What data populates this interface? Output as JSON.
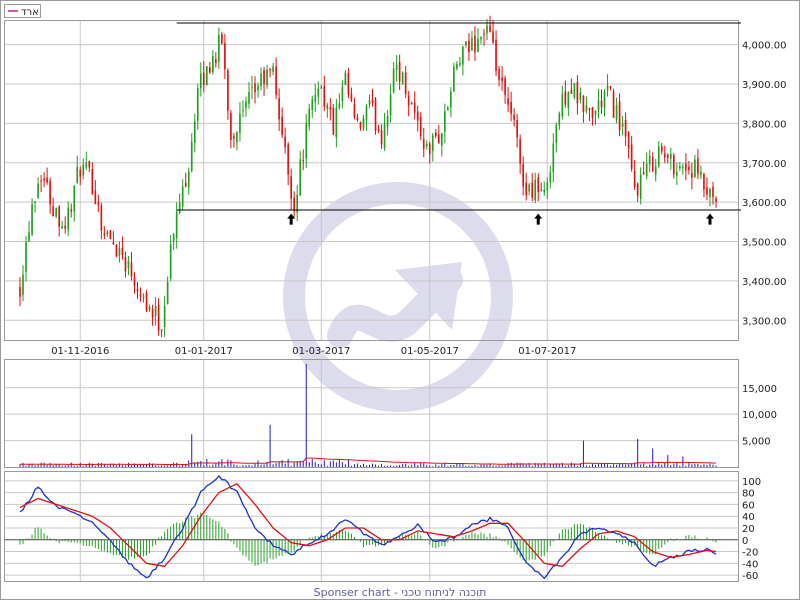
{
  "legend": {
    "label": "ארד",
    "color": "#d11b8a"
  },
  "footer": {
    "text": "Sponser chart - תוכנה לניתוח טכני"
  },
  "colors": {
    "up": "#1f9e1f",
    "down": "#e01010",
    "volume": "#1a1acb",
    "volume_ma": "#e01010",
    "macd": "#1a33c9",
    "signal": "#e01010",
    "hist": "#28a028",
    "grid": "#c8c8c8",
    "watermark": "#d6d6ea"
  },
  "chart_data": [
    {
      "type": "candlestick",
      "panel": "price",
      "y_ticks": [
        "4,000.00",
        "3,900.00",
        "3,800.00",
        "3,700.00",
        "3,600.00",
        "3,500.00",
        "3,400.00",
        "3,300.00"
      ],
      "ylim": [
        3250,
        4060
      ],
      "x_ticks": [
        "01-11-2016",
        "01-01-2017",
        "01-03-2017",
        "01-05-2017",
        "01-07-2017"
      ],
      "x_tick_index": [
        20,
        61,
        100,
        136,
        175
      ],
      "n_bars": 232,
      "resistance": {
        "level": 4055,
        "from_index": 52,
        "to_index": 231
      },
      "support": {
        "level": 3580,
        "from_index": 52,
        "to_index": 231
      },
      "markers": [
        {
          "index": 90,
          "value": 3553
        },
        {
          "index": 172,
          "value": 3553
        },
        {
          "index": 229,
          "value": 3553
        }
      ],
      "keypoints": [
        {
          "i": 0,
          "v": 3390
        },
        {
          "i": 4,
          "v": 3600
        },
        {
          "i": 7,
          "v": 3680
        },
        {
          "i": 11,
          "v": 3590
        },
        {
          "i": 15,
          "v": 3540
        },
        {
          "i": 20,
          "v": 3690
        },
        {
          "i": 24,
          "v": 3650
        },
        {
          "i": 28,
          "v": 3520
        },
        {
          "i": 33,
          "v": 3480
        },
        {
          "i": 38,
          "v": 3410
        },
        {
          "i": 43,
          "v": 3330
        },
        {
          "i": 47,
          "v": 3290
        },
        {
          "i": 50,
          "v": 3480
        },
        {
          "i": 53,
          "v": 3600
        },
        {
          "i": 56,
          "v": 3700
        },
        {
          "i": 59,
          "v": 3880
        },
        {
          "i": 63,
          "v": 3950
        },
        {
          "i": 67,
          "v": 4010
        },
        {
          "i": 70,
          "v": 3770
        },
        {
          "i": 74,
          "v": 3820
        },
        {
          "i": 79,
          "v": 3900
        },
        {
          "i": 84,
          "v": 3930
        },
        {
          "i": 88,
          "v": 3720
        },
        {
          "i": 91,
          "v": 3590
        },
        {
          "i": 95,
          "v": 3780
        },
        {
          "i": 99,
          "v": 3910
        },
        {
          "i": 104,
          "v": 3790
        },
        {
          "i": 108,
          "v": 3900
        },
        {
          "i": 112,
          "v": 3780
        },
        {
          "i": 116,
          "v": 3840
        },
        {
          "i": 120,
          "v": 3770
        },
        {
          "i": 125,
          "v": 3950
        },
        {
          "i": 130,
          "v": 3850
        },
        {
          "i": 135,
          "v": 3730
        },
        {
          "i": 140,
          "v": 3780
        },
        {
          "i": 145,
          "v": 3950
        },
        {
          "i": 150,
          "v": 4000
        },
        {
          "i": 155,
          "v": 4040
        },
        {
          "i": 160,
          "v": 3880
        },
        {
          "i": 164,
          "v": 3790
        },
        {
          "i": 168,
          "v": 3620
        },
        {
          "i": 171,
          "v": 3650
        },
        {
          "i": 174,
          "v": 3610
        },
        {
          "i": 178,
          "v": 3800
        },
        {
          "i": 182,
          "v": 3900
        },
        {
          "i": 186,
          "v": 3850
        },
        {
          "i": 190,
          "v": 3820
        },
        {
          "i": 195,
          "v": 3880
        },
        {
          "i": 200,
          "v": 3790
        },
        {
          "i": 204,
          "v": 3630
        },
        {
          "i": 208,
          "v": 3680
        },
        {
          "i": 212,
          "v": 3730
        },
        {
          "i": 216,
          "v": 3700
        },
        {
          "i": 220,
          "v": 3690
        },
        {
          "i": 224,
          "v": 3680
        },
        {
          "i": 228,
          "v": 3620
        },
        {
          "i": 231,
          "v": 3580
        }
      ]
    },
    {
      "type": "bar",
      "panel": "volume",
      "y_ticks": [
        "15,000",
        "10,000",
        "5,000"
      ],
      "ylim": [
        0,
        19500
      ],
      "spikes": [
        {
          "index": 57,
          "value": 6200
        },
        {
          "index": 83,
          "value": 8000
        },
        {
          "index": 95,
          "value": 19500
        },
        {
          "index": 187,
          "value": 5000
        },
        {
          "index": 205,
          "value": 5300
        },
        {
          "index": 210,
          "value": 3500
        },
        {
          "index": 215,
          "value": 2300
        },
        {
          "index": 220,
          "value": 2000
        }
      ]
    },
    {
      "type": "line",
      "panel": "macd",
      "y_ticks": [
        "100",
        "80",
        "60",
        "40",
        "20",
        "0",
        "-20",
        "-40",
        "-60"
      ],
      "ylim": [
        -70,
        115
      ],
      "series": [
        {
          "name": "",
          "keypoints": [
            {
              "i": 0,
              "v": 45
            },
            {
              "i": 6,
              "v": 90
            },
            {
              "i": 12,
              "v": 55
            },
            {
              "i": 18,
              "v": 45
            },
            {
              "i": 24,
              "v": 30
            },
            {
              "i": 30,
              "v": 0
            },
            {
              "i": 36,
              "v": -40
            },
            {
              "i": 42,
              "v": -65
            },
            {
              "i": 48,
              "v": -30
            },
            {
              "i": 54,
              "v": 20
            },
            {
              "i": 60,
              "v": 80
            },
            {
              "i": 66,
              "v": 110
            },
            {
              "i": 72,
              "v": 80
            },
            {
              "i": 78,
              "v": 20
            },
            {
              "i": 84,
              "v": -10
            },
            {
              "i": 90,
              "v": -25
            },
            {
              "i": 96,
              "v": -5
            },
            {
              "i": 102,
              "v": 10
            },
            {
              "i": 108,
              "v": 35
            },
            {
              "i": 114,
              "v": 10
            },
            {
              "i": 120,
              "v": -10
            },
            {
              "i": 126,
              "v": 5
            },
            {
              "i": 132,
              "v": 25
            },
            {
              "i": 138,
              "v": -5
            },
            {
              "i": 144,
              "v": 5
            },
            {
              "i": 150,
              "v": 25
            },
            {
              "i": 156,
              "v": 35
            },
            {
              "i": 162,
              "v": 20
            },
            {
              "i": 168,
              "v": -40
            },
            {
              "i": 174,
              "v": -65
            },
            {
              "i": 180,
              "v": -30
            },
            {
              "i": 186,
              "v": 10
            },
            {
              "i": 192,
              "v": 20
            },
            {
              "i": 198,
              "v": 10
            },
            {
              "i": 204,
              "v": -5
            },
            {
              "i": 210,
              "v": -45
            },
            {
              "i": 216,
              "v": -30
            },
            {
              "i": 222,
              "v": -20
            },
            {
              "i": 228,
              "v": -15
            },
            {
              "i": 231,
              "v": -25
            }
          ]
        },
        {
          "name": "",
          "keypoints": [
            {
              "i": 0,
              "v": 55
            },
            {
              "i": 6,
              "v": 70
            },
            {
              "i": 12,
              "v": 60
            },
            {
              "i": 18,
              "v": 50
            },
            {
              "i": 24,
              "v": 40
            },
            {
              "i": 30,
              "v": 20
            },
            {
              "i": 36,
              "v": -10
            },
            {
              "i": 42,
              "v": -40
            },
            {
              "i": 48,
              "v": -45
            },
            {
              "i": 54,
              "v": -10
            },
            {
              "i": 60,
              "v": 40
            },
            {
              "i": 66,
              "v": 80
            },
            {
              "i": 72,
              "v": 95
            },
            {
              "i": 78,
              "v": 60
            },
            {
              "i": 84,
              "v": 20
            },
            {
              "i": 90,
              "v": -5
            },
            {
              "i": 96,
              "v": -10
            },
            {
              "i": 102,
              "v": 0
            },
            {
              "i": 108,
              "v": 20
            },
            {
              "i": 114,
              "v": 20
            },
            {
              "i": 120,
              "v": 0
            },
            {
              "i": 126,
              "v": 0
            },
            {
              "i": 132,
              "v": 15
            },
            {
              "i": 138,
              "v": 10
            },
            {
              "i": 144,
              "v": 5
            },
            {
              "i": 150,
              "v": 15
            },
            {
              "i": 156,
              "v": 28
            },
            {
              "i": 162,
              "v": 28
            },
            {
              "i": 168,
              "v": -5
            },
            {
              "i": 174,
              "v": -40
            },
            {
              "i": 180,
              "v": -45
            },
            {
              "i": 186,
              "v": -15
            },
            {
              "i": 192,
              "v": 10
            },
            {
              "i": 198,
              "v": 15
            },
            {
              "i": 204,
              "v": 5
            },
            {
              "i": 210,
              "v": -20
            },
            {
              "i": 216,
              "v": -30
            },
            {
              "i": 222,
              "v": -25
            },
            {
              "i": 228,
              "v": -18
            },
            {
              "i": 231,
              "v": -20
            }
          ]
        }
      ]
    }
  ]
}
